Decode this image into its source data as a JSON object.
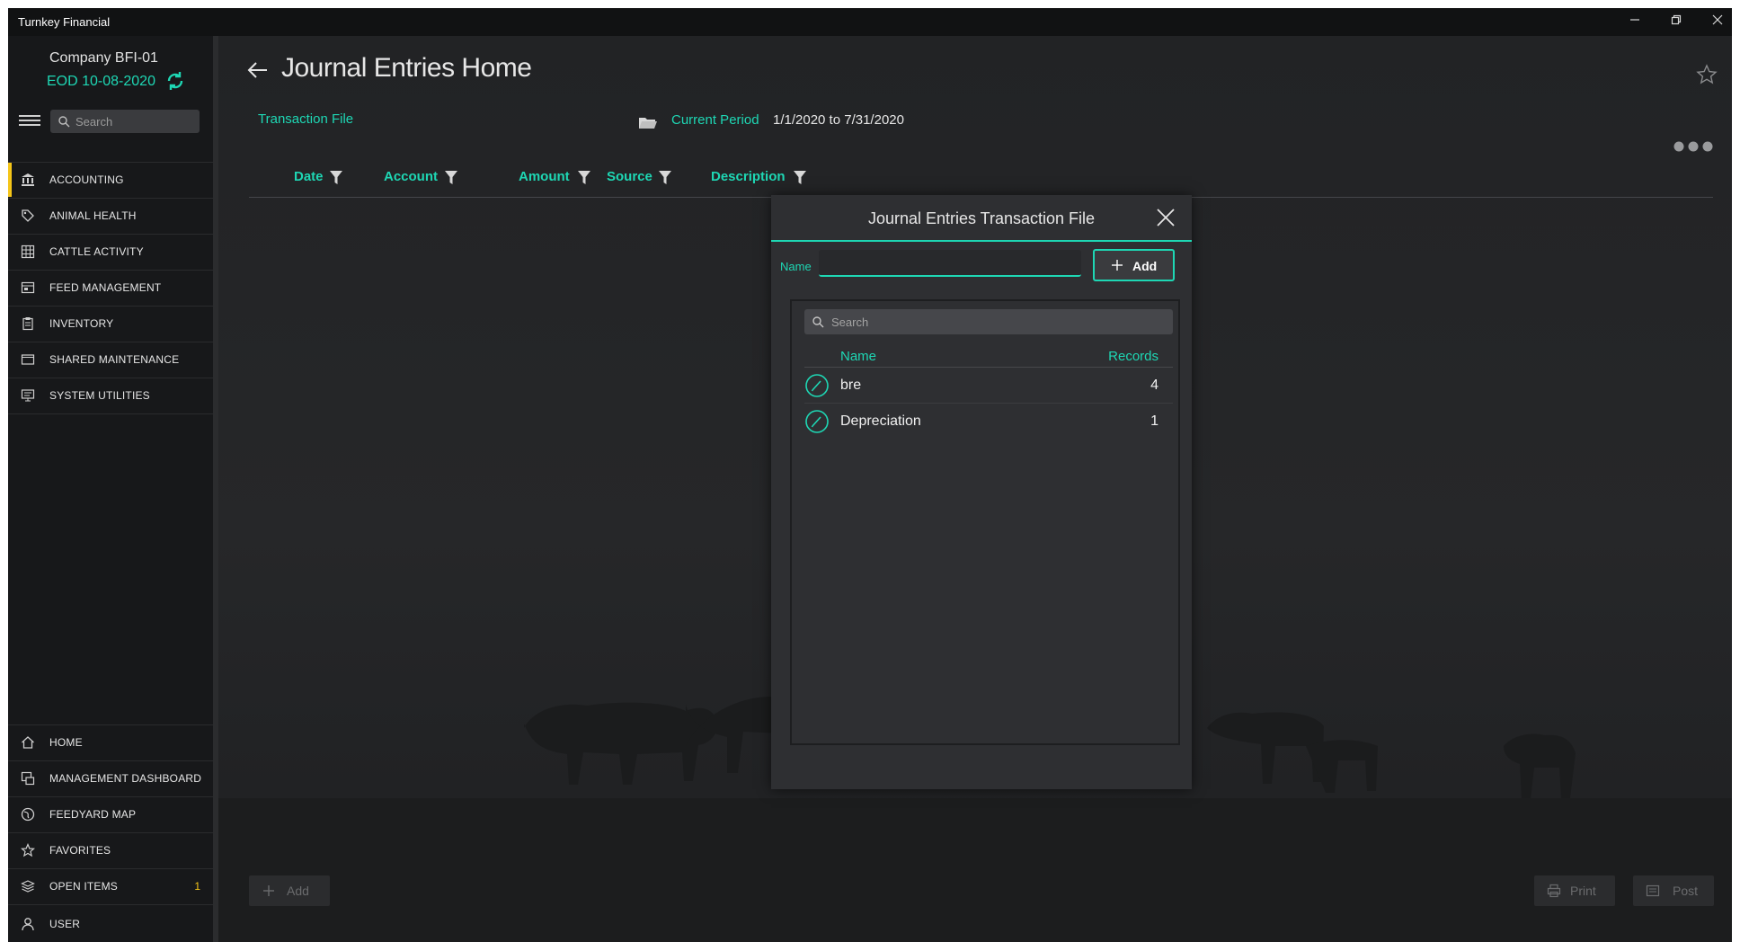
{
  "window": {
    "app_title": "Turnkey Financial",
    "controls": [
      "minimize",
      "restore",
      "close"
    ]
  },
  "sidebar": {
    "company": "Company BFI-01",
    "eod": "EOD 10-08-2020",
    "search_placeholder": "Search",
    "top_items": [
      {
        "label": "ACCOUNTING",
        "icon": "bank-icon",
        "active": true
      },
      {
        "label": "ANIMAL HEALTH",
        "icon": "tag-icon"
      },
      {
        "label": "CATTLE ACTIVITY",
        "icon": "grid-icon"
      },
      {
        "label": "FEED MANAGEMENT",
        "icon": "feed-icon"
      },
      {
        "label": "INVENTORY",
        "icon": "clipboard-icon"
      },
      {
        "label": "SHARED MAINTENANCE",
        "icon": "window-icon"
      },
      {
        "label": "SYSTEM UTILITIES",
        "icon": "monitor-icon"
      }
    ],
    "bottom_items": [
      {
        "label": "HOME",
        "icon": "home-icon"
      },
      {
        "label": "MANAGEMENT DASHBOARD",
        "icon": "dashboard-icon"
      },
      {
        "label": "FEEDYARD MAP",
        "icon": "globe-icon"
      },
      {
        "label": "FAVORITES",
        "icon": "star-icon"
      },
      {
        "label": "OPEN ITEMS",
        "icon": "layers-icon",
        "badge": "1"
      },
      {
        "label": "USER",
        "icon": "user-icon"
      }
    ]
  },
  "main": {
    "title": "Journal Entries Home",
    "transaction_file_label": "Transaction File",
    "current_period_label": "Current Period",
    "current_period_value": "1/1/2020 to 7/31/2020",
    "columns": [
      "Date",
      "Account",
      "Amount",
      "Source",
      "Description"
    ],
    "buttons": {
      "add": "Add",
      "print": "Print",
      "post": "Post"
    }
  },
  "modal": {
    "title": "Journal Entries Transaction File",
    "name_label": "Name",
    "name_value": "",
    "add_label": "Add",
    "search_placeholder": "Search",
    "list_headers": {
      "name": "Name",
      "records": "Records"
    },
    "rows": [
      {
        "name": "bre",
        "records": "4"
      },
      {
        "name": "Depreciation",
        "records": "1"
      }
    ]
  },
  "colors": {
    "accent": "#1ed7b4",
    "active_marker": "#f5c518",
    "background": "#222325",
    "sidebar": "#17181a"
  }
}
